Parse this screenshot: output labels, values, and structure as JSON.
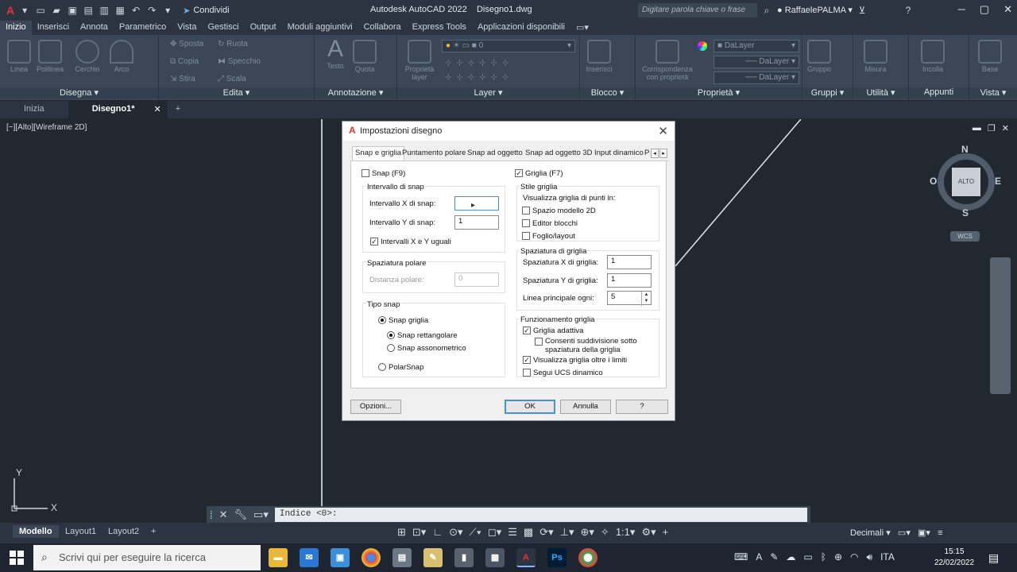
{
  "app": {
    "title": "Autodesk AutoCAD 2022",
    "document": "Disegno1.dwg",
    "share_label": "Condividi",
    "search_placeholder": "Digitare parola chiave o frase",
    "user": "RaffaelePALMA"
  },
  "ribbon_tabs": [
    "Inizio",
    "Inserisci",
    "Annota",
    "Parametrico",
    "Vista",
    "Gestisci",
    "Output",
    "Moduli aggiuntivi",
    "Collabora",
    "Express Tools",
    "Applicazioni disponibili"
  ],
  "ribbon": {
    "draw": {
      "label": "Disegna",
      "buttons": [
        "Linea",
        "Polilinea",
        "Cerchio",
        "Arco"
      ]
    },
    "edit": {
      "label": "Edita",
      "items": [
        "Sposta",
        "Ruota",
        "Copia",
        "Specchio",
        "Stira",
        "Scala"
      ]
    },
    "annotation": {
      "label": "Annotazione",
      "buttons": [
        "Testo",
        "Quota"
      ]
    },
    "layers": {
      "label": "Layer",
      "button": "Proprietà layer",
      "combo": "0"
    },
    "block": {
      "label": "Blocco",
      "button": "Inserisci"
    },
    "properties": {
      "label": "Proprietà",
      "button": "Corrispondenza con proprietà",
      "combos": [
        "DaLayer",
        "DaLayer",
        "DaLayer"
      ]
    },
    "groups": {
      "label": "Gruppi",
      "button": "Gruppo"
    },
    "utilities": {
      "label": "Utilità",
      "button": "Misura"
    },
    "clipboard": {
      "label": "Appunti",
      "button": "Incolla"
    },
    "view": {
      "label": "Vista",
      "button": "Base"
    }
  },
  "doc_tabs": {
    "start": "Inizia",
    "current": "Disegno1*"
  },
  "viewport": {
    "label": "[−][Alto][Wireframe 2D]"
  },
  "viewcube": {
    "face": "ALTO",
    "n": "N",
    "s": "S",
    "e": "E",
    "w": "O",
    "wcs": "WCS"
  },
  "ucs": {
    "x": "X",
    "y": "Y"
  },
  "command_line": {
    "prompt": "Indice <0>:"
  },
  "layout_tabs": [
    "Modello",
    "Layout1",
    "Layout2"
  ],
  "status": {
    "units": "Decimali",
    "scale": "1:1"
  },
  "taskbar": {
    "search": "Scrivi qui per eseguire la ricerca",
    "time": "15:15",
    "date": "22/02/2022"
  },
  "dialog": {
    "title": "Impostazioni disegno",
    "tabs": [
      "Snap e griglia",
      "Puntamento polare",
      "Snap ad oggetto",
      "Snap ad oggetto 3D",
      "Input dinamico",
      "P"
    ],
    "snap_on": "Snap (F9)",
    "grid_on": "Griglia (F7)",
    "snap_interval": {
      "title": "Intervallo di snap",
      "x_label": "Intervallo X di snap:",
      "x_value": "",
      "y_label": "Intervallo Y di snap:",
      "y_value": "1",
      "equal": "Intervalli X e Y uguali"
    },
    "polar_spacing": {
      "title": "Spaziatura polare",
      "label": "Distanza polare:",
      "value": "0"
    },
    "snap_type": {
      "title": "Tipo snap",
      "grid_snap": "Snap griglia",
      "rect": "Snap rettangolare",
      "iso": "Snap assonometrico",
      "polar": "PolarSnap"
    },
    "grid_style": {
      "title": "Stile griglia",
      "subtitle": "Visualizza griglia di punti in:",
      "model": "Spazio modello 2D",
      "block": "Editor blocchi",
      "sheet": "Foglio/layout"
    },
    "grid_spacing": {
      "title": "Spaziatura di griglia",
      "x_label": "Spaziatura X di griglia:",
      "x_value": "1",
      "y_label": "Spaziatura Y di griglia:",
      "y_value": "1",
      "major_label": "Linea principale ogni:",
      "major_value": "5"
    },
    "grid_behavior": {
      "title": "Funzionamento griglia",
      "adaptive": "Griglia adattiva",
      "subdivide": "Consenti suddivisione sotto spaziatura della griglia",
      "beyond": "Visualizza griglia oltre i limiti",
      "ucs": "Segui UCS dinamico"
    },
    "buttons": {
      "options": "Opzioni...",
      "ok": "OK",
      "cancel": "Annulla",
      "help": "?"
    }
  }
}
